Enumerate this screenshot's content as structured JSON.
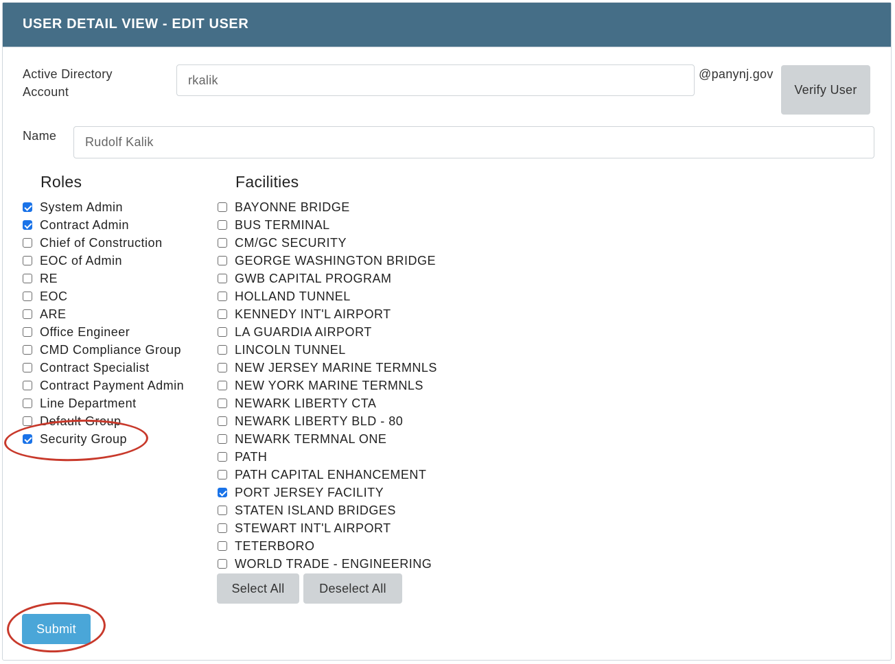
{
  "header": {
    "title": "USER DETAIL VIEW - EDIT USER"
  },
  "form": {
    "ad_account_label": "Active Directory Account",
    "ad_account_value": "rkalik",
    "ad_domain_suffix": "@panynj.gov",
    "verify_button": "Verify User",
    "name_label": "Name",
    "name_value": "Rudolf Kalik"
  },
  "roles": {
    "title": "Roles",
    "items": [
      {
        "label": "System Admin",
        "checked": true
      },
      {
        "label": "Contract Admin",
        "checked": true
      },
      {
        "label": "Chief of Construction",
        "checked": false
      },
      {
        "label": "EOC of Admin",
        "checked": false
      },
      {
        "label": "RE",
        "checked": false
      },
      {
        "label": "EOC",
        "checked": false
      },
      {
        "label": "ARE",
        "checked": false
      },
      {
        "label": "Office Engineer",
        "checked": false
      },
      {
        "label": "CMD Compliance Group",
        "checked": false
      },
      {
        "label": "Contract Specialist",
        "checked": false
      },
      {
        "label": "Contract Payment Admin",
        "checked": false
      },
      {
        "label": "Line Department",
        "checked": false
      },
      {
        "label": "Default Group",
        "checked": false
      },
      {
        "label": "Security Group",
        "checked": true
      }
    ]
  },
  "facilities": {
    "title": "Facilities",
    "items": [
      {
        "label": "BAYONNE BRIDGE",
        "checked": false
      },
      {
        "label": "BUS TERMINAL",
        "checked": false
      },
      {
        "label": "CM/GC SECURITY",
        "checked": false
      },
      {
        "label": "GEORGE WASHINGTON BRIDGE",
        "checked": false
      },
      {
        "label": "GWB CAPITAL PROGRAM",
        "checked": false
      },
      {
        "label": "HOLLAND TUNNEL",
        "checked": false
      },
      {
        "label": "KENNEDY INT'L AIRPORT",
        "checked": false
      },
      {
        "label": "LA GUARDIA AIRPORT",
        "checked": false
      },
      {
        "label": "LINCOLN TUNNEL",
        "checked": false
      },
      {
        "label": "NEW JERSEY MARINE TERMNLS",
        "checked": false
      },
      {
        "label": "NEW YORK MARINE TERMNLS",
        "checked": false
      },
      {
        "label": "NEWARK LIBERTY CTA",
        "checked": false
      },
      {
        "label": "NEWARK LIBERTY BLD - 80",
        "checked": false
      },
      {
        "label": "NEWARK TERMNAL ONE",
        "checked": false
      },
      {
        "label": "PATH",
        "checked": false
      },
      {
        "label": "PATH CAPITAL ENHANCEMENT",
        "checked": false
      },
      {
        "label": "PORT JERSEY FACILITY",
        "checked": true
      },
      {
        "label": "STATEN ISLAND BRIDGES",
        "checked": false
      },
      {
        "label": "STEWART INT'L AIRPORT",
        "checked": false
      },
      {
        "label": "TETERBORO",
        "checked": false
      },
      {
        "label": "WORLD TRADE - ENGINEERING",
        "checked": false
      }
    ],
    "select_all_button": "Select All",
    "deselect_all_button": "Deselect All"
  },
  "submit_button": "Submit",
  "colors": {
    "header_bg": "#456e87",
    "submit_bg": "#4aa6d8",
    "checkbox_checked": "#1a73e8",
    "annotation": "#c8392b"
  }
}
